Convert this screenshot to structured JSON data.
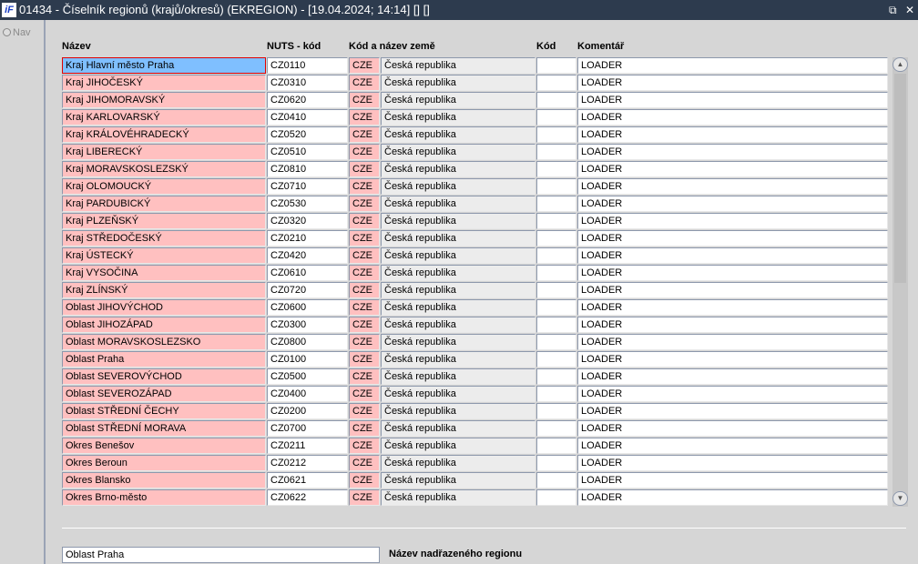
{
  "window": {
    "logo": "iF",
    "title": "01434 - Číselník regionů (krajů/okresů) (EKREGION) - [19.04.2024; 14:14] [] []",
    "restore_icon": "⧉",
    "close_icon": "✕"
  },
  "nav": {
    "label": "Nav"
  },
  "headers": {
    "name": "Název",
    "nuts": "NUTS - kód",
    "country": "Kód a název země",
    "kod": "Kód",
    "comment": "Komentář"
  },
  "rows": [
    {
      "name": "Kraj Hlavní město Praha",
      "nuts": "CZ0110",
      "cc": "CZE",
      "country": "Česká republika",
      "kod": "",
      "comment": "LOADER"
    },
    {
      "name": "Kraj JIHOČESKÝ",
      "nuts": "CZ0310",
      "cc": "CZE",
      "country": "Česká republika",
      "kod": "",
      "comment": "LOADER"
    },
    {
      "name": "Kraj JIHOMORAVSKÝ",
      "nuts": "CZ0620",
      "cc": "CZE",
      "country": "Česká republika",
      "kod": "",
      "comment": "LOADER"
    },
    {
      "name": "Kraj KARLOVARSKÝ",
      "nuts": "CZ0410",
      "cc": "CZE",
      "country": "Česká republika",
      "kod": "",
      "comment": "LOADER"
    },
    {
      "name": "Kraj KRÁLOVÉHRADECKÝ",
      "nuts": "CZ0520",
      "cc": "CZE",
      "country": "Česká republika",
      "kod": "",
      "comment": "LOADER"
    },
    {
      "name": "Kraj LIBERECKÝ",
      "nuts": "CZ0510",
      "cc": "CZE",
      "country": "Česká republika",
      "kod": "",
      "comment": "LOADER"
    },
    {
      "name": "Kraj MORAVSKOSLEZSKÝ",
      "nuts": "CZ0810",
      "cc": "CZE",
      "country": "Česká republika",
      "kod": "",
      "comment": "LOADER"
    },
    {
      "name": "Kraj OLOMOUCKÝ",
      "nuts": "CZ0710",
      "cc": "CZE",
      "country": "Česká republika",
      "kod": "",
      "comment": "LOADER"
    },
    {
      "name": "Kraj PARDUBICKÝ",
      "nuts": "CZ0530",
      "cc": "CZE",
      "country": "Česká republika",
      "kod": "",
      "comment": "LOADER"
    },
    {
      "name": "Kraj PLZEŇSKÝ",
      "nuts": "CZ0320",
      "cc": "CZE",
      "country": "Česká republika",
      "kod": "",
      "comment": "LOADER"
    },
    {
      "name": "Kraj STŘEDOČESKÝ",
      "nuts": "CZ0210",
      "cc": "CZE",
      "country": "Česká republika",
      "kod": "",
      "comment": "LOADER"
    },
    {
      "name": "Kraj ÚSTECKÝ",
      "nuts": "CZ0420",
      "cc": "CZE",
      "country": "Česká republika",
      "kod": "",
      "comment": "LOADER"
    },
    {
      "name": "Kraj VYSOČINA",
      "nuts": "CZ0610",
      "cc": "CZE",
      "country": "Česká republika",
      "kod": "",
      "comment": "LOADER"
    },
    {
      "name": "Kraj ZLÍNSKÝ",
      "nuts": "CZ0720",
      "cc": "CZE",
      "country": "Česká republika",
      "kod": "",
      "comment": "LOADER"
    },
    {
      "name": "Oblast JIHOVÝCHOD",
      "nuts": "CZ0600",
      "cc": "CZE",
      "country": "Česká republika",
      "kod": "",
      "comment": "LOADER"
    },
    {
      "name": "Oblast JIHOZÁPAD",
      "nuts": "CZ0300",
      "cc": "CZE",
      "country": "Česká republika",
      "kod": "",
      "comment": "LOADER"
    },
    {
      "name": "Oblast MORAVSKOSLEZSKO",
      "nuts": "CZ0800",
      "cc": "CZE",
      "country": "Česká republika",
      "kod": "",
      "comment": "LOADER"
    },
    {
      "name": "Oblast Praha",
      "nuts": "CZ0100",
      "cc": "CZE",
      "country": "Česká republika",
      "kod": "",
      "comment": "LOADER"
    },
    {
      "name": "Oblast SEVEROVÝCHOD",
      "nuts": "CZ0500",
      "cc": "CZE",
      "country": "Česká republika",
      "kod": "",
      "comment": "LOADER"
    },
    {
      "name": "Oblast SEVEROZÁPAD",
      "nuts": "CZ0400",
      "cc": "CZE",
      "country": "Česká republika",
      "kod": "",
      "comment": "LOADER"
    },
    {
      "name": "Oblast STŘEDNÍ ČECHY",
      "nuts": "CZ0200",
      "cc": "CZE",
      "country": "Česká republika",
      "kod": "",
      "comment": "LOADER"
    },
    {
      "name": "Oblast STŘEDNÍ MORAVA",
      "nuts": "CZ0700",
      "cc": "CZE",
      "country": "Česká republika",
      "kod": "",
      "comment": "LOADER"
    },
    {
      "name": "Okres Benešov",
      "nuts": "CZ0211",
      "cc": "CZE",
      "country": "Česká republika",
      "kod": "",
      "comment": "LOADER"
    },
    {
      "name": "Okres Beroun",
      "nuts": "CZ0212",
      "cc": "CZE",
      "country": "Česká republika",
      "kod": "",
      "comment": "LOADER"
    },
    {
      "name": "Okres Blansko",
      "nuts": "CZ0621",
      "cc": "CZE",
      "country": "Česká republika",
      "kod": "",
      "comment": "LOADER"
    },
    {
      "name": "Okres Brno-město",
      "nuts": "CZ0622",
      "cc": "CZE",
      "country": "Česká republika",
      "kod": "",
      "comment": "LOADER"
    }
  ],
  "parent": {
    "value": "Oblast Praha",
    "label": "Název nadřazeného regionu"
  }
}
